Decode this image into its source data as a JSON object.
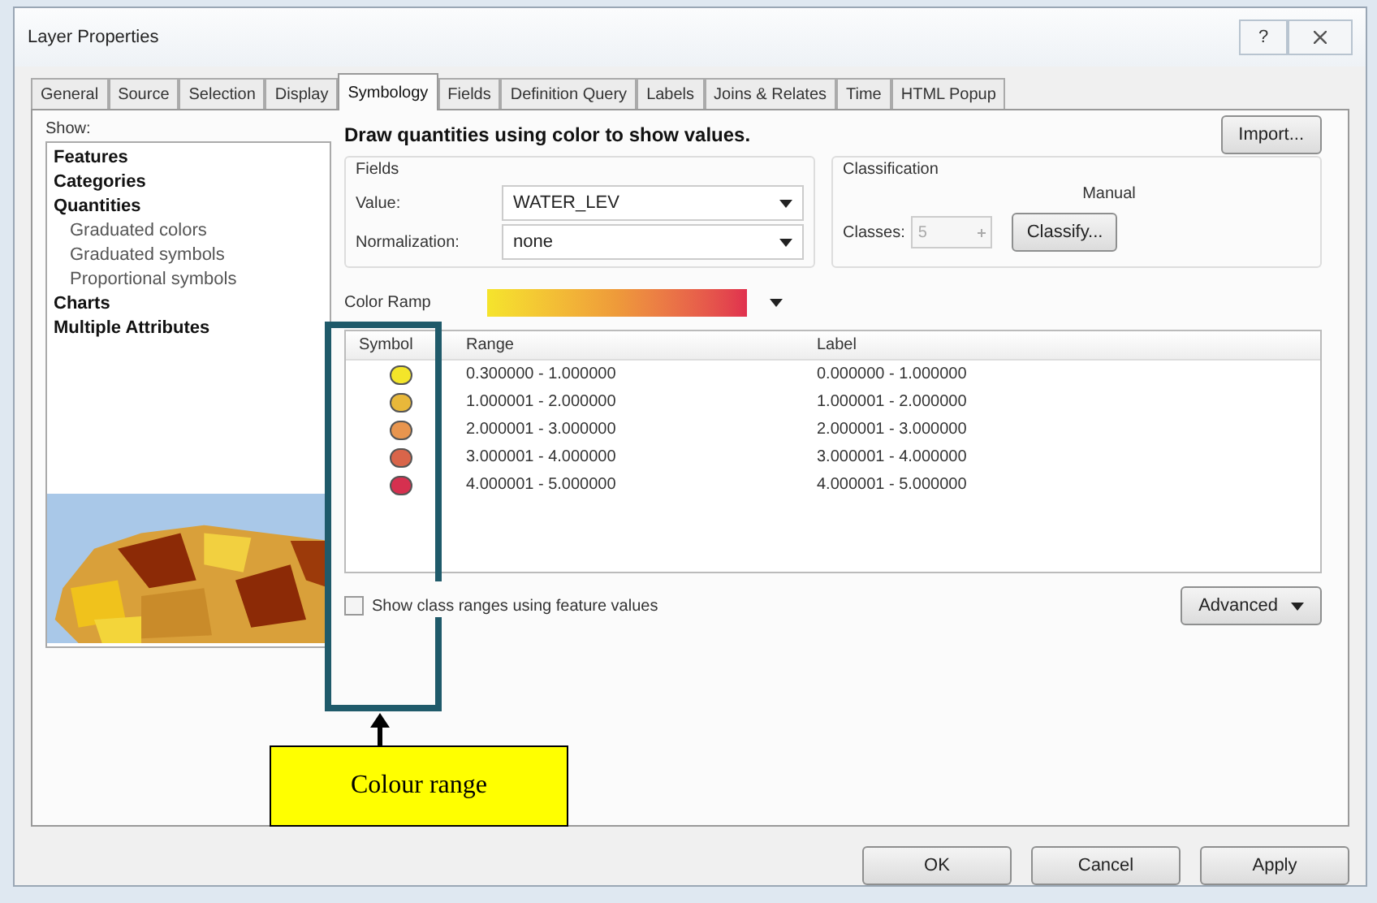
{
  "window": {
    "title": "Layer Properties",
    "help_button": "?"
  },
  "tabs": [
    {
      "label": "General",
      "selected": false
    },
    {
      "label": "Source",
      "selected": false
    },
    {
      "label": "Selection",
      "selected": false
    },
    {
      "label": "Display",
      "selected": false
    },
    {
      "label": "Symbology",
      "selected": true
    },
    {
      "label": "Fields",
      "selected": false
    },
    {
      "label": "Definition Query",
      "selected": false
    },
    {
      "label": "Labels",
      "selected": false
    },
    {
      "label": "Joins & Relates",
      "selected": false
    },
    {
      "label": "Time",
      "selected": false
    },
    {
      "label": "HTML Popup",
      "selected": false
    }
  ],
  "show": {
    "label": "Show:",
    "items": [
      {
        "label": "Features"
      },
      {
        "label": "Categories"
      },
      {
        "label": "Quantities",
        "children": [
          {
            "label": "Graduated colors"
          },
          {
            "label": "Graduated symbols"
          },
          {
            "label": "Proportional symbols"
          }
        ]
      },
      {
        "label": "Charts"
      },
      {
        "label": "Multiple Attributes"
      }
    ]
  },
  "heading": "Draw quantities using color to show values.",
  "import_button": "Import...",
  "fields": {
    "title": "Fields",
    "value_label": "Value:",
    "value": "WATER_LEV",
    "normalization_label": "Normalization:",
    "normalization": "none"
  },
  "classification": {
    "title": "Classification",
    "method": "Manual",
    "classes_label": "Classes:",
    "classes": "5",
    "classes_disabled": true,
    "classify_button": "Classify..."
  },
  "color_ramp": {
    "label": "Color Ramp"
  },
  "table": {
    "columns": [
      "Symbol",
      "Range",
      "Label"
    ],
    "rows": [
      {
        "color": "#f3e52a",
        "range": "0.300000 - 1.000000",
        "label": "0.000000 - 1.000000"
      },
      {
        "color": "#e8b83a",
        "range": "1.000001 - 2.000000",
        "label": "1.000001 - 2.000000"
      },
      {
        "color": "#e8954e",
        "range": "2.000001 - 3.000000",
        "label": "2.000001 - 3.000000"
      },
      {
        "color": "#d9654a",
        "range": "3.000001 - 4.000000",
        "label": "3.000001 - 4.000000"
      },
      {
        "color": "#d6304f",
        "range": "4.000001 - 5.000000",
        "label": "4.000001 - 5.000000"
      }
    ]
  },
  "show_class_ranges": {
    "label": "Show class ranges using feature values",
    "checked": false
  },
  "advanced_button": "Advanced",
  "annotation": {
    "label": "Colour range"
  },
  "buttons": [
    "OK",
    "Cancel",
    "Apply"
  ]
}
